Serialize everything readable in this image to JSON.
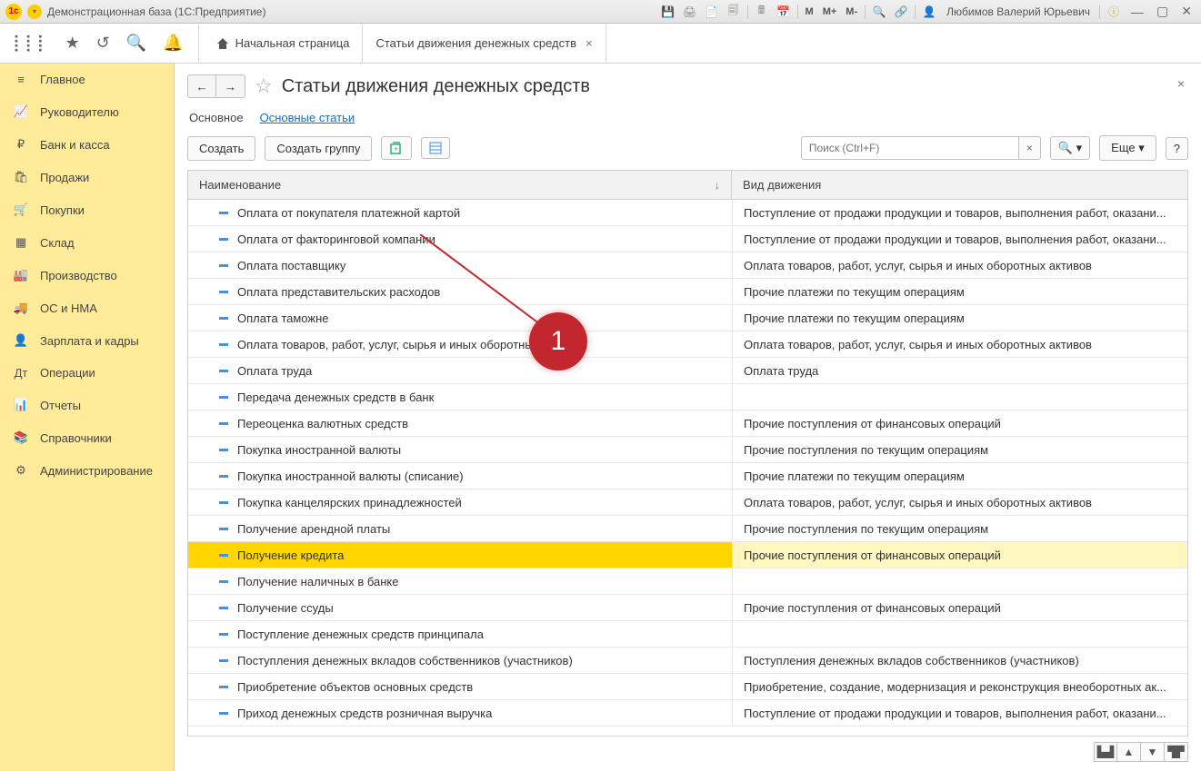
{
  "titlebar": {
    "app": "Демонстрационная база  (1С:Предприятие)",
    "user": "Любимов Валерий Юрьевич"
  },
  "toptabs": {
    "home": "Начальная страница",
    "active": "Статьи движения денежных средств"
  },
  "sidebar": {
    "items": [
      {
        "icon": "≡",
        "label": "Главное"
      },
      {
        "icon": "📈",
        "label": "Руководителю"
      },
      {
        "icon": "₽",
        "label": "Банк и касса"
      },
      {
        "icon": "🛍",
        "label": "Продажи"
      },
      {
        "icon": "🛒",
        "label": "Покупки"
      },
      {
        "icon": "▦",
        "label": "Склад"
      },
      {
        "icon": "🏭",
        "label": "Производство"
      },
      {
        "icon": "🚚",
        "label": "ОС и НМА"
      },
      {
        "icon": "👤",
        "label": "Зарплата и кадры"
      },
      {
        "icon": "Дт",
        "label": "Операции"
      },
      {
        "icon": "📊",
        "label": "Отчеты"
      },
      {
        "icon": "📚",
        "label": "Справочники"
      },
      {
        "icon": "⚙",
        "label": "Администрирование"
      }
    ]
  },
  "page": {
    "title": "Статьи движения денежных средств",
    "subtabs": {
      "main": "Основное",
      "secondary": "Основные статьи"
    }
  },
  "toolbar": {
    "create": "Создать",
    "create_group": "Создать группу",
    "search_placeholder": "Поиск (Ctrl+F)",
    "more": "Еще"
  },
  "table": {
    "col_name": "Наименование",
    "col_move": "Вид движения",
    "rows": [
      {
        "name": "Оплата от покупателя платежной картой",
        "move": "Поступление от продажи продукции и товаров, выполнения работ, оказани..."
      },
      {
        "name": "Оплата от факторинговой компании",
        "move": "Поступление от продажи продукции и товаров, выполнения работ, оказани...",
        "warn": true
      },
      {
        "name": "Оплата поставщику",
        "move": "Оплата товаров, работ, услуг, сырья и иных оборотных активов"
      },
      {
        "name": "Оплата представительских расходов",
        "move": "Прочие платежи по текущим операциям"
      },
      {
        "name": "Оплата таможне",
        "move": "Прочие платежи по текущим операциям"
      },
      {
        "name": "Оплата товаров, работ, услуг, сырья и иных оборотных активов",
        "move": "Оплата товаров, работ, услуг, сырья и иных оборотных активов"
      },
      {
        "name": "Оплата труда",
        "move": "Оплата труда"
      },
      {
        "name": "Передача денежных средств в банк",
        "move": ""
      },
      {
        "name": "Переоценка валютных средств",
        "move": "Прочие поступления от финансовых операций"
      },
      {
        "name": "Покупка иностранной валюты",
        "move": "Прочие поступления по текущим операциям"
      },
      {
        "name": "Покупка иностранной валюты (списание)",
        "move": "Прочие платежи по текущим операциям"
      },
      {
        "name": "Покупка канцелярских принадлежностей",
        "move": "Оплата товаров, работ, услуг, сырья и иных оборотных активов"
      },
      {
        "name": "Получение арендной платы",
        "move": "Прочие поступления по текущим операциям"
      },
      {
        "name": "Получение кредита",
        "move": "Прочие поступления от финансовых операций",
        "selected": true
      },
      {
        "name": "Получение наличных в банке",
        "move": ""
      },
      {
        "name": "Получение ссуды",
        "move": "Прочие поступления от финансовых операций"
      },
      {
        "name": "Поступление денежных средств принципала",
        "move": ""
      },
      {
        "name": "Поступления денежных вкладов собственников (участников)",
        "move": "Поступления денежных вкладов собственников (участников)"
      },
      {
        "name": "Приобретение объектов основных средств",
        "move": "Приобретение, создание, модернизация и реконструкция внеоборотных ак..."
      },
      {
        "name": "Приход денежных средств розничная выручка",
        "move": "Поступление от продажи продукции и товаров, выполнения работ, оказани..."
      }
    ]
  },
  "annotation": {
    "number": "1"
  }
}
